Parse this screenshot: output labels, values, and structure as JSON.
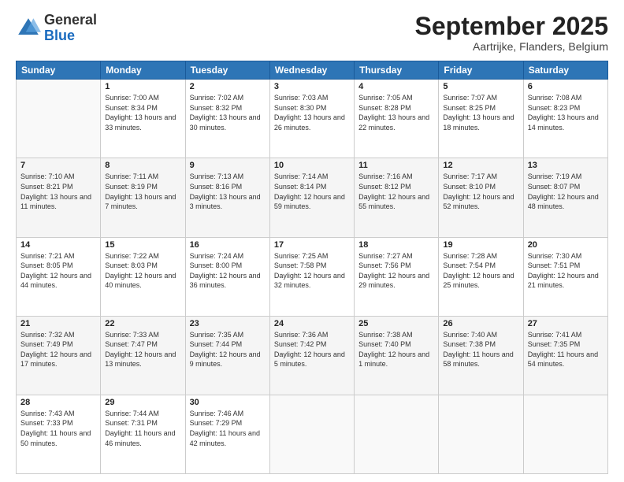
{
  "logo": {
    "general": "General",
    "blue": "Blue"
  },
  "header": {
    "month": "September 2025",
    "location": "Aartrijke, Flanders, Belgium"
  },
  "days_of_week": [
    "Sunday",
    "Monday",
    "Tuesday",
    "Wednesday",
    "Thursday",
    "Friday",
    "Saturday"
  ],
  "weeks": [
    [
      {
        "day": "",
        "sunrise": "",
        "sunset": "",
        "daylight": ""
      },
      {
        "day": "1",
        "sunrise": "Sunrise: 7:00 AM",
        "sunset": "Sunset: 8:34 PM",
        "daylight": "Daylight: 13 hours and 33 minutes."
      },
      {
        "day": "2",
        "sunrise": "Sunrise: 7:02 AM",
        "sunset": "Sunset: 8:32 PM",
        "daylight": "Daylight: 13 hours and 30 minutes."
      },
      {
        "day": "3",
        "sunrise": "Sunrise: 7:03 AM",
        "sunset": "Sunset: 8:30 PM",
        "daylight": "Daylight: 13 hours and 26 minutes."
      },
      {
        "day": "4",
        "sunrise": "Sunrise: 7:05 AM",
        "sunset": "Sunset: 8:28 PM",
        "daylight": "Daylight: 13 hours and 22 minutes."
      },
      {
        "day": "5",
        "sunrise": "Sunrise: 7:07 AM",
        "sunset": "Sunset: 8:25 PM",
        "daylight": "Daylight: 13 hours and 18 minutes."
      },
      {
        "day": "6",
        "sunrise": "Sunrise: 7:08 AM",
        "sunset": "Sunset: 8:23 PM",
        "daylight": "Daylight: 13 hours and 14 minutes."
      }
    ],
    [
      {
        "day": "7",
        "sunrise": "Sunrise: 7:10 AM",
        "sunset": "Sunset: 8:21 PM",
        "daylight": "Daylight: 13 hours and 11 minutes."
      },
      {
        "day": "8",
        "sunrise": "Sunrise: 7:11 AM",
        "sunset": "Sunset: 8:19 PM",
        "daylight": "Daylight: 13 hours and 7 minutes."
      },
      {
        "day": "9",
        "sunrise": "Sunrise: 7:13 AM",
        "sunset": "Sunset: 8:16 PM",
        "daylight": "Daylight: 13 hours and 3 minutes."
      },
      {
        "day": "10",
        "sunrise": "Sunrise: 7:14 AM",
        "sunset": "Sunset: 8:14 PM",
        "daylight": "Daylight: 12 hours and 59 minutes."
      },
      {
        "day": "11",
        "sunrise": "Sunrise: 7:16 AM",
        "sunset": "Sunset: 8:12 PM",
        "daylight": "Daylight: 12 hours and 55 minutes."
      },
      {
        "day": "12",
        "sunrise": "Sunrise: 7:17 AM",
        "sunset": "Sunset: 8:10 PM",
        "daylight": "Daylight: 12 hours and 52 minutes."
      },
      {
        "day": "13",
        "sunrise": "Sunrise: 7:19 AM",
        "sunset": "Sunset: 8:07 PM",
        "daylight": "Daylight: 12 hours and 48 minutes."
      }
    ],
    [
      {
        "day": "14",
        "sunrise": "Sunrise: 7:21 AM",
        "sunset": "Sunset: 8:05 PM",
        "daylight": "Daylight: 12 hours and 44 minutes."
      },
      {
        "day": "15",
        "sunrise": "Sunrise: 7:22 AM",
        "sunset": "Sunset: 8:03 PM",
        "daylight": "Daylight: 12 hours and 40 minutes."
      },
      {
        "day": "16",
        "sunrise": "Sunrise: 7:24 AM",
        "sunset": "Sunset: 8:00 PM",
        "daylight": "Daylight: 12 hours and 36 minutes."
      },
      {
        "day": "17",
        "sunrise": "Sunrise: 7:25 AM",
        "sunset": "Sunset: 7:58 PM",
        "daylight": "Daylight: 12 hours and 32 minutes."
      },
      {
        "day": "18",
        "sunrise": "Sunrise: 7:27 AM",
        "sunset": "Sunset: 7:56 PM",
        "daylight": "Daylight: 12 hours and 29 minutes."
      },
      {
        "day": "19",
        "sunrise": "Sunrise: 7:28 AM",
        "sunset": "Sunset: 7:54 PM",
        "daylight": "Daylight: 12 hours and 25 minutes."
      },
      {
        "day": "20",
        "sunrise": "Sunrise: 7:30 AM",
        "sunset": "Sunset: 7:51 PM",
        "daylight": "Daylight: 12 hours and 21 minutes."
      }
    ],
    [
      {
        "day": "21",
        "sunrise": "Sunrise: 7:32 AM",
        "sunset": "Sunset: 7:49 PM",
        "daylight": "Daylight: 12 hours and 17 minutes."
      },
      {
        "day": "22",
        "sunrise": "Sunrise: 7:33 AM",
        "sunset": "Sunset: 7:47 PM",
        "daylight": "Daylight: 12 hours and 13 minutes."
      },
      {
        "day": "23",
        "sunrise": "Sunrise: 7:35 AM",
        "sunset": "Sunset: 7:44 PM",
        "daylight": "Daylight: 12 hours and 9 minutes."
      },
      {
        "day": "24",
        "sunrise": "Sunrise: 7:36 AM",
        "sunset": "Sunset: 7:42 PM",
        "daylight": "Daylight: 12 hours and 5 minutes."
      },
      {
        "day": "25",
        "sunrise": "Sunrise: 7:38 AM",
        "sunset": "Sunset: 7:40 PM",
        "daylight": "Daylight: 12 hours and 1 minute."
      },
      {
        "day": "26",
        "sunrise": "Sunrise: 7:40 AM",
        "sunset": "Sunset: 7:38 PM",
        "daylight": "Daylight: 11 hours and 58 minutes."
      },
      {
        "day": "27",
        "sunrise": "Sunrise: 7:41 AM",
        "sunset": "Sunset: 7:35 PM",
        "daylight": "Daylight: 11 hours and 54 minutes."
      }
    ],
    [
      {
        "day": "28",
        "sunrise": "Sunrise: 7:43 AM",
        "sunset": "Sunset: 7:33 PM",
        "daylight": "Daylight: 11 hours and 50 minutes."
      },
      {
        "day": "29",
        "sunrise": "Sunrise: 7:44 AM",
        "sunset": "Sunset: 7:31 PM",
        "daylight": "Daylight: 11 hours and 46 minutes."
      },
      {
        "day": "30",
        "sunrise": "Sunrise: 7:46 AM",
        "sunset": "Sunset: 7:29 PM",
        "daylight": "Daylight: 11 hours and 42 minutes."
      },
      {
        "day": "",
        "sunrise": "",
        "sunset": "",
        "daylight": ""
      },
      {
        "day": "",
        "sunrise": "",
        "sunset": "",
        "daylight": ""
      },
      {
        "day": "",
        "sunrise": "",
        "sunset": "",
        "daylight": ""
      },
      {
        "day": "",
        "sunrise": "",
        "sunset": "",
        "daylight": ""
      }
    ]
  ]
}
